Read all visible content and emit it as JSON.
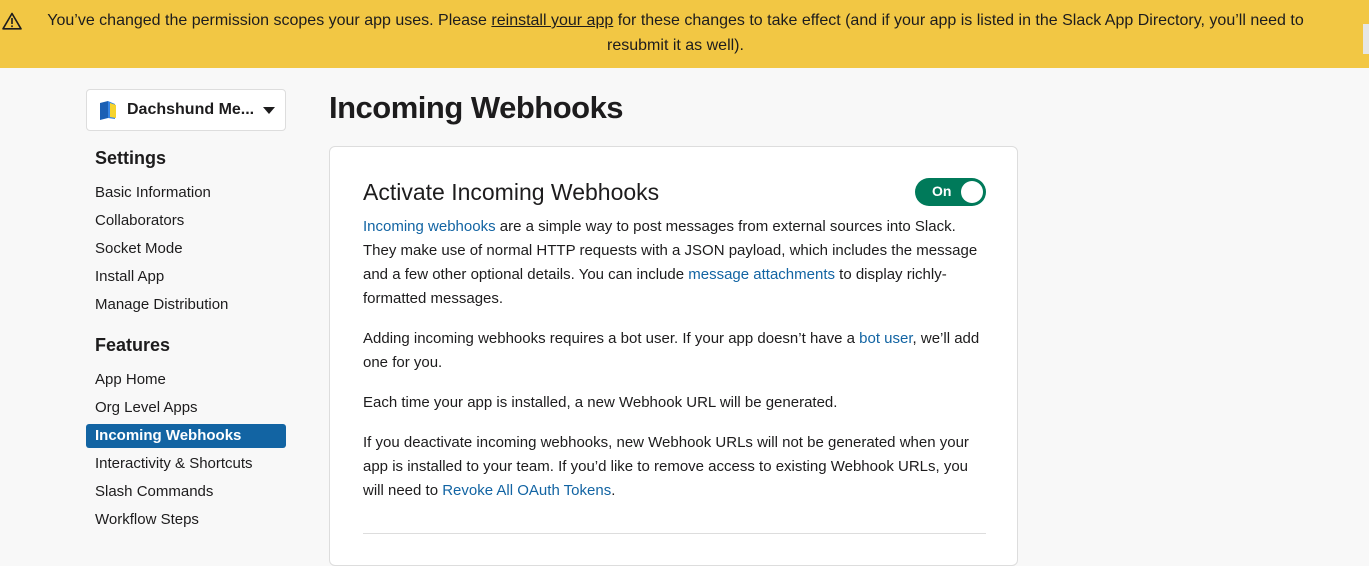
{
  "banner": {
    "text_before": "You’ve changed the permission scopes your app uses. Please ",
    "link": "reinstall your app",
    "text_after": " for these changes to take effect (and if your app is listed in the Slack App Directory, you’ll need to resubmit it as well).",
    "color": "#f2c744"
  },
  "app_switcher": {
    "name": "Dachshund Me..."
  },
  "sidebar": {
    "settings_title": "Settings",
    "settings_items": [
      {
        "label": "Basic Information"
      },
      {
        "label": "Collaborators"
      },
      {
        "label": "Socket Mode"
      },
      {
        "label": "Install App"
      },
      {
        "label": "Manage Distribution"
      }
    ],
    "features_title": "Features",
    "features_items": [
      {
        "label": "App Home"
      },
      {
        "label": "Org Level Apps"
      },
      {
        "label": "Incoming Webhooks"
      },
      {
        "label": "Interactivity & Shortcuts"
      },
      {
        "label": "Slash Commands"
      },
      {
        "label": "Workflow Steps"
      }
    ],
    "active_item": "Incoming Webhooks",
    "active_color": "#1264a3"
  },
  "page": {
    "title": "Incoming Webhooks"
  },
  "card": {
    "title": "Activate Incoming Webhooks",
    "toggle_label": "On",
    "toggle_color": "#007a5a",
    "p1": {
      "link1": "Incoming webhooks",
      "text1": " are a simple way to post messages from external sources into Slack. They make use of normal HTTP requests with a JSON payload, which includes the message and a few other optional details. You can include ",
      "link2": "message attachments",
      "text2": " to display richly-formatted messages."
    },
    "p2": {
      "text1": "Adding incoming webhooks requires a bot user. If your app doesn’t have a ",
      "link1": "bot user",
      "text2": ", we’ll add one for you."
    },
    "p3": {
      "text1": "Each time your app is installed, a new Webhook URL will be generated."
    },
    "p4": {
      "text1": "If you deactivate incoming webhooks, new Webhook URLs will not be generated when your app is installed to your team. If you’d like to remove access to existing Webhook URLs, you will need to ",
      "link1": "Revoke All OAuth Tokens",
      "text2": "."
    },
    "link_color": "#1264a3"
  }
}
